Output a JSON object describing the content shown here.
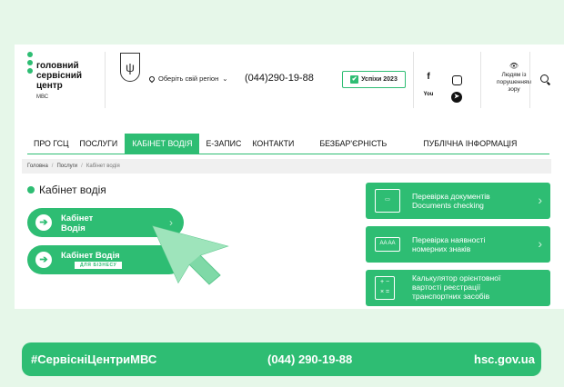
{
  "header": {
    "logo_lines": [
      "головний",
      "сервісний",
      "центр"
    ],
    "logo_sub": "МВС",
    "region_label": "Оберіть свій регіон",
    "phone": "(044)290-19-88",
    "success_label": "Успіхи 2023",
    "social": {
      "facebook": "f",
      "youtube": "You"
    },
    "accessibility_label": "Людям із порушенням зору"
  },
  "nav": {
    "items": [
      "ПРО ГСЦ",
      "ПОСЛУГИ",
      "КАБІНЕТ ВОДІЯ",
      "Е-ЗАПИС",
      "КОНТАКТИ",
      "БЕЗБАР'ЄРНІСТЬ",
      "ПУБЛІЧНА ІНФОРМАЦІЯ"
    ],
    "active_index": 2
  },
  "breadcrumbs": [
    "Головна",
    "Послуги",
    "Кабінет водія"
  ],
  "page_title": "Кабінет водія",
  "left_buttons": [
    {
      "line1": "Кабінет",
      "line2": "Водія"
    },
    {
      "line1": "Кабінет Водія",
      "sub": "ДЛЯ БІЗНЕСУ"
    }
  ],
  "right_cards": [
    {
      "lines": [
        "Перевірка документів",
        "Documents checking"
      ],
      "icon": "id-card-icon"
    },
    {
      "lines": [
        "Перевірка наявності",
        "номерних знаків"
      ],
      "icon": "license-plate-icon",
      "icon_text": "AA AA"
    },
    {
      "lines": [
        "Калькулятор орієнтовної",
        "вартості реєстрації",
        "транспортних засобів"
      ],
      "icon": "calculator-icon"
    }
  ],
  "footer": {
    "hashtag": "#СервісніЦентриМВС",
    "phone": "(044) 290-19-88",
    "site": "hsc.gov.ua"
  },
  "colors": {
    "accent": "#2ebd73",
    "background": "#e6f7e9"
  }
}
